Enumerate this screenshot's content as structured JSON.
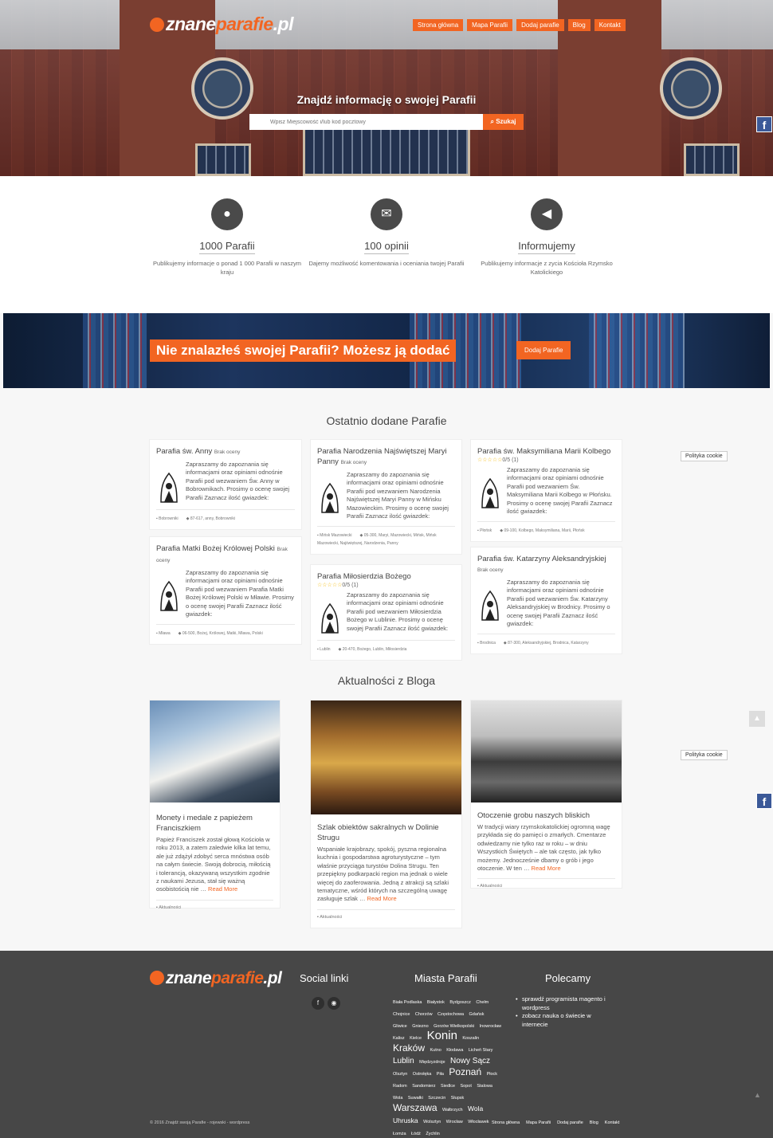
{
  "header": {
    "logo": {
      "part1": "znane",
      "part2": "parafie",
      "part3": ".pl"
    },
    "nav": [
      "Strona główna",
      "Mapa Parafii",
      "Dodaj parafie",
      "Blog",
      "Kontakt"
    ]
  },
  "hero": {
    "title": "Znajdź informację o swojej Parafii",
    "search_placeholder": "Wpisz Miejscowość i/lub kod pocztowy",
    "search_button": "Szukaj"
  },
  "features": [
    {
      "icon": "user-icon",
      "title": "1000 Parafii",
      "desc": "Publikujemy informacje o ponad 1 000 Parafii w naszym kraju"
    },
    {
      "icon": "comments-icon",
      "title": "100 opinii",
      "desc": "Dajemy możliwość komentowania i oceniania twojej Parafii"
    },
    {
      "icon": "bullhorn-icon",
      "title": "Informujemy",
      "desc": "Publikujemy informacje z zycia Kościoła Rzymsko Katolickiego"
    }
  ],
  "banner": {
    "text": "Nie znalazłeś swojej Parafii? Możesz ją dodać",
    "button": "Dodaj Parafie"
  },
  "parishes_title": "Ostatnio dodane Parafie",
  "parishes": [
    {
      "title": "Parafia św. Anny",
      "rating": "Brak oceny",
      "stars": "",
      "desc": "Zapraszamy do zapoznania się informacjami oraz opiniami odnośnie Parafii pod wezwaniem Św. Anny w Bobrownikach. Prosimy o ocenę swojej Parafii Zaznacz ilość gwiazdek:",
      "category": "Bobrowniki",
      "tags": "87-617, anny, Bobrowniki"
    },
    {
      "title": "Parafia Matki Bożej Królowej Polski",
      "rating": "Brak oceny",
      "stars": "",
      "desc": "Zapraszamy do zapoznania się informacjami oraz opiniami odnośnie Parafii pod wezwaniem Parafia Matki Bożej Królowej Polski w Mławie. Prosimy o ocenę swojej Parafii Zaznacz ilość gwiazdek:",
      "category": "Mława",
      "tags": "06-500, Bożej, Królowej, Matki, Mława, Polski"
    },
    {
      "title": "Parafia Narodzenia Najświętszej Maryi Panny",
      "rating": "Brak oceny",
      "stars": "",
      "desc": "Zapraszamy do zapoznania się informacjami oraz opiniami odnośnie Parafii pod wezwaniem Narodzenia Najświętszej Maryi Panny w Mińsku Mazowieckim. Prosimy o ocenę swojej Parafii Zaznacz ilość gwiazdek:",
      "category": "Mińsk Mazowiecki",
      "tags": "05-300, Maryi, Mazowiecki, Mińsk, Mińsk Mazowiecki, Najświętszej, Narodzenia, Panny"
    },
    {
      "title": "Parafia Miłosierdzia Bożego",
      "rating": "",
      "stars": "☆☆☆☆☆",
      "stars_value": "0/5 (1)",
      "desc": "Zapraszamy do zapoznania się informacjami oraz opiniami odnośnie Parafii pod wezwaniem Miłosierdzia Bożego w Lublinie. Prosimy o ocenę swojej Parafii Zaznacz ilość gwiazdek:",
      "category": "Lublin",
      "tags": "20-470, Bożego, Lublin, Miłosierdzia"
    },
    {
      "title": "Parafia św. Maksymiliana Marii Kolbego",
      "rating": "",
      "stars": "☆☆☆☆☆",
      "stars_value": "0/5 (1)",
      "desc": "Zapraszamy do zapoznania się informacjami oraz opiniami odnośnie Parafii pod wezwaniem Św. Maksymiliana Marii Kolbego w Płońsku. Prosimy o ocenę swojej Parafii Zaznacz ilość gwiazdek:",
      "category": "Płońsk",
      "tags": "09-100, Kolbego, Maksymiliana, Marii, Płońsk"
    },
    {
      "title": "Parafia św. Katarzyny Aleksandryjskiej",
      "rating": "Brak oceny",
      "stars": "",
      "desc": "Zapraszamy do zapoznania się informacjami oraz opiniami odnośnie Parafii pod wezwaniem Św. Katarzyny Aleksandryjskiej w Brodnicy. Prosimy o ocenę swojej Parafii Zaznacz ilość gwiazdek:",
      "category": "Brodnica",
      "tags": "87-300, Aleksandryjskiej, Brodnica, Katarzyny"
    }
  ],
  "cookie_label": "Polityka cookie",
  "blog_title": "Aktualności z Bloga",
  "posts": [
    {
      "title": "Monety i medale z papieżem Franciszkiem",
      "desc": "Papież Franciszek został głową Kościoła w roku 2013, a zatem zaledwie kilka lat temu, ale już zdążył zdobyć serca mnóstwa osób na całym świecie. Swoją dobrocią, miłością i tolerancją, okazywaną wszystkim zgodnie z naukami Jezusa, stał się ważną osobistością nie …",
      "more": "Read More",
      "category": "Aktualności"
    },
    {
      "title": "Szlak obiektów sakralnych w Dolinie Strugu",
      "desc": "Wspaniałe krajobrazy, spokój, pyszna regionalna kuchnia i gospodarstwa agroturystyczne – tym właśnie przyciąga turystów Dolina Strugu. Ten przepiękny podkarpacki region ma jednak o wiele więcej do zaoferowania. Jedną z atrakcji są szlaki tematyczne, wśród których na szczególną uwagę zasługuje szlak …",
      "more": "Read More",
      "category": "Aktualności"
    },
    {
      "title": "Otoczenie grobu naszych bliskich",
      "desc": "W tradycji wiary rzymskokatolickiej ogromną wagę przykłada się do pamięci o zmarłych. Cmentarze odwiedzamy nie tylko raz w roku – w dniu Wszystkich Świętych – ale tak często, jak tylko możemy. Jednocześnie dbamy o grób i jego otoczenie. W ten …",
      "more": "Read More",
      "category": "Aktualności"
    }
  ],
  "footer": {
    "social_title": "Social linki",
    "cities_title": "Miasta Parafii",
    "recommend_title": "Polecamy",
    "recommend": [
      "sprawdź programista magento i wordpress",
      "zobacz nauka o świecie w internecie"
    ],
    "cities": [
      {
        "n": "Biała Podlaska",
        "s": 5.5
      },
      {
        "n": "Białystok",
        "s": 5.5
      },
      {
        "n": "Bydgoszcz",
        "s": 5.5
      },
      {
        "n": "Chełm",
        "s": 5.5
      },
      {
        "n": "Chojnice",
        "s": 5.5
      },
      {
        "n": "Chorzów",
        "s": 5.5
      },
      {
        "n": "Częstochowa",
        "s": 5.5
      },
      {
        "n": "Gdańsk",
        "s": 5.5
      },
      {
        "n": "Gliwice",
        "s": 5.5
      },
      {
        "n": "Gniezno",
        "s": 5.5
      },
      {
        "n": "Gorzów Wielkopolski",
        "s": 5.5
      },
      {
        "n": "Inowrocław",
        "s": 5.5
      },
      {
        "n": "Kalisz",
        "s": 5.5
      },
      {
        "n": "Kielce",
        "s": 5.5
      },
      {
        "n": "Konin",
        "s": 15
      },
      {
        "n": "Koszalin",
        "s": 5.5
      },
      {
        "n": "Kraków",
        "s": 12
      },
      {
        "n": "Kutno",
        "s": 5.5
      },
      {
        "n": "Kłodawa",
        "s": 5.5
      },
      {
        "n": "Licheń Stary",
        "s": 5.5
      },
      {
        "n": "Lublin",
        "s": 10
      },
      {
        "n": "Międzyzdroje",
        "s": 5.5
      },
      {
        "n": "Nowy Sącz",
        "s": 10
      },
      {
        "n": "Olsztyn",
        "s": 5.5
      },
      {
        "n": "Ostrołęka",
        "s": 5.5
      },
      {
        "n": "Piła",
        "s": 5.5
      },
      {
        "n": "Poznań",
        "s": 12
      },
      {
        "n": "Płock",
        "s": 5.5
      },
      {
        "n": "Radom",
        "s": 5.5
      },
      {
        "n": "Sandomierz",
        "s": 5.5
      },
      {
        "n": "Siedlce",
        "s": 5.5
      },
      {
        "n": "Sopot",
        "s": 5.5
      },
      {
        "n": "Stalowa Wola",
        "s": 5.5
      },
      {
        "n": "Suwałki",
        "s": 5.5
      },
      {
        "n": "Szczecin",
        "s": 5.5
      },
      {
        "n": "Słupsk",
        "s": 5.5
      },
      {
        "n": "Warszawa",
        "s": 12
      },
      {
        "n": "Wałbrzych",
        "s": 5.5
      },
      {
        "n": "Wola Uhruska",
        "s": 8.5
      },
      {
        "n": "Wolsztyn",
        "s": 5.5
      },
      {
        "n": "Wrocław",
        "s": 5.5
      },
      {
        "n": "Włocławek",
        "s": 5.5
      },
      {
        "n": "Łomża",
        "s": 5.5
      },
      {
        "n": "Łódź",
        "s": 5.5
      },
      {
        "n": "Żychlin",
        "s": 5.5
      }
    ],
    "copyright": "© 2016 Znajdź swoją Parafie - rojewski - wordpress",
    "nav": [
      "Strona główna",
      "Mapa Parafii",
      "Dodaj parafie",
      "Blog",
      "Kontakt"
    ]
  },
  "colors": {
    "accent": "#f26522",
    "footer_bg": "#474747",
    "facebook": "#3b5998"
  }
}
